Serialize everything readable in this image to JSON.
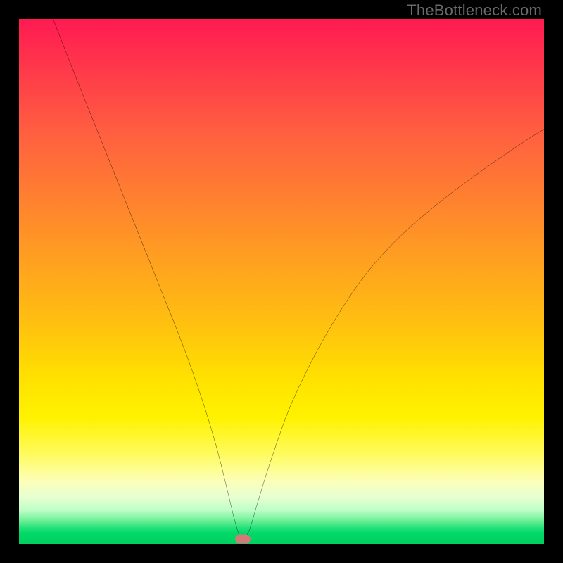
{
  "watermark": "TheBottleneck.com",
  "chart_data": {
    "type": "line",
    "title": "",
    "xlabel": "",
    "ylabel": "",
    "xlim": [
      0,
      100
    ],
    "ylim": [
      0,
      100
    ],
    "grid": false,
    "legend": false,
    "background_gradient": {
      "orientation": "vertical",
      "stops": [
        {
          "pos": 0.0,
          "color": "#ff1a52"
        },
        {
          "pos": 0.5,
          "color": "#ffb010"
        },
        {
          "pos": 0.75,
          "color": "#fff200"
        },
        {
          "pos": 0.92,
          "color": "#e0ffd0"
        },
        {
          "pos": 1.0,
          "color": "#00d060"
        }
      ]
    },
    "series": [
      {
        "name": "bottleneck-curve",
        "color": "#000000",
        "x": [
          6.5,
          10,
          14,
          18,
          22,
          26,
          30,
          33,
          36,
          38,
          39.5,
          40.7,
          41.5,
          42.2,
          43.0,
          44.0,
          45.5,
          48,
          52,
          58,
          65,
          72,
          80,
          88,
          96,
          100
        ],
        "y": [
          100,
          91,
          81,
          71,
          61,
          51,
          41,
          33,
          24,
          17,
          11,
          6,
          3,
          1.2,
          1.2,
          3,
          8,
          16,
          27,
          39,
          50,
          58,
          65,
          71,
          76.5,
          79
        ]
      }
    ],
    "marker": {
      "name": "optimal-point",
      "x": 42.6,
      "y": 0.9,
      "shape": "pill",
      "color": "#d17a79"
    }
  }
}
